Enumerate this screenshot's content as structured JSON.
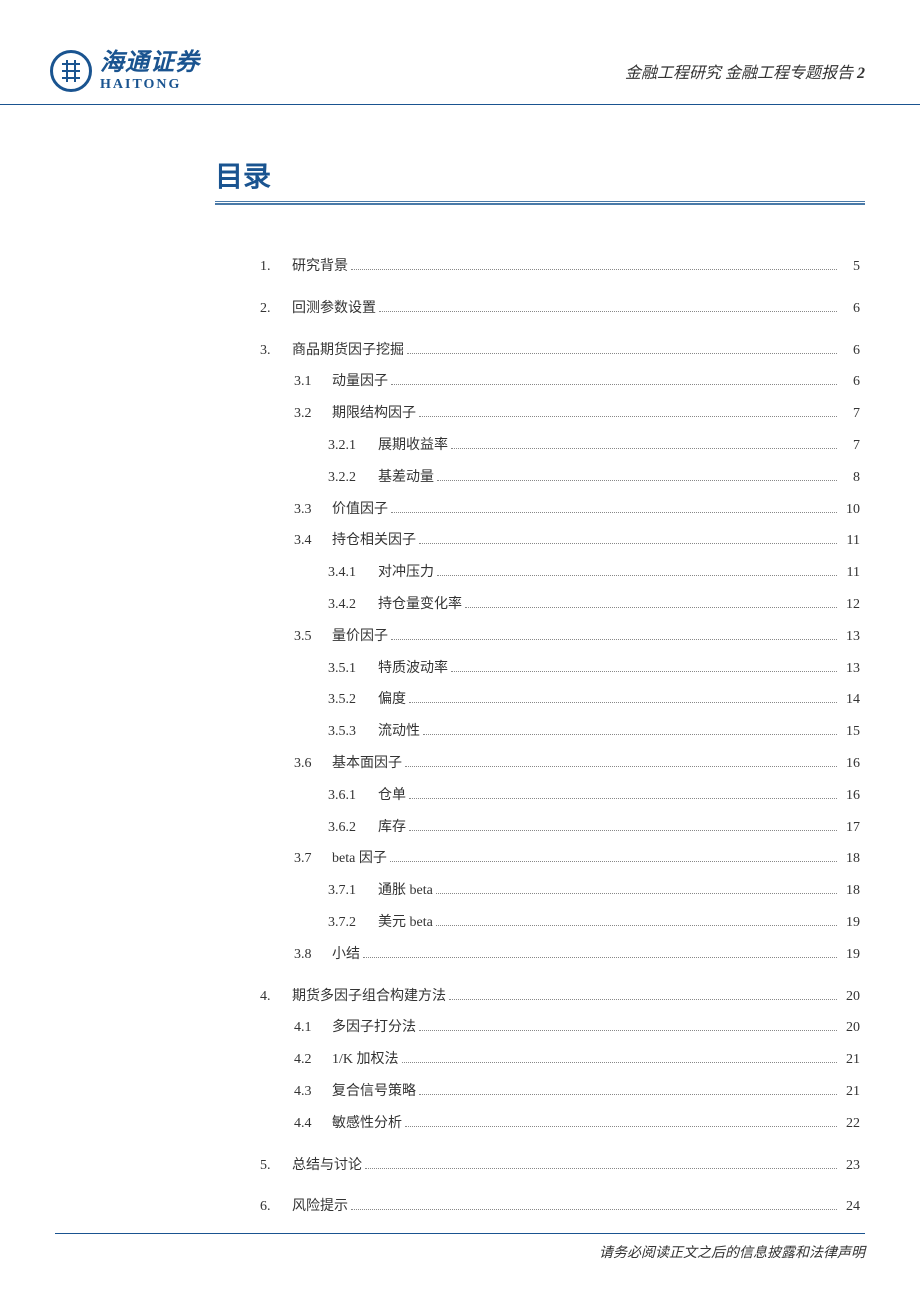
{
  "header": {
    "brand_cn": "海通证券",
    "brand_en": "HAITONG",
    "right_text_prefix": "金融工程研究 金融工程专题报告",
    "right_text_num": "2"
  },
  "title": "目录",
  "toc": [
    {
      "level": 1,
      "num": "1.",
      "label": "研究背景",
      "page": "5"
    },
    {
      "level": 1,
      "num": "2.",
      "label": "回测参数设置",
      "page": "6"
    },
    {
      "level": 1,
      "num": "3.",
      "label": "商品期货因子挖掘",
      "page": "6"
    },
    {
      "level": 2,
      "num": "3.1",
      "label": "动量因子",
      "page": "6"
    },
    {
      "level": 2,
      "num": "3.2",
      "label": "期限结构因子",
      "page": "7"
    },
    {
      "level": 3,
      "num": "3.2.1",
      "label": "展期收益率",
      "page": "7"
    },
    {
      "level": 3,
      "num": "3.2.2",
      "label": "基差动量",
      "page": "8"
    },
    {
      "level": 2,
      "num": "3.3",
      "label": "价值因子",
      "page": "10"
    },
    {
      "level": 2,
      "num": "3.4",
      "label": "持仓相关因子",
      "page": "11"
    },
    {
      "level": 3,
      "num": "3.4.1",
      "label": "对冲压力",
      "page": "11"
    },
    {
      "level": 3,
      "num": "3.4.2",
      "label": "持仓量变化率",
      "page": "12"
    },
    {
      "level": 2,
      "num": "3.5",
      "label": "量价因子",
      "page": "13"
    },
    {
      "level": 3,
      "num": "3.5.1",
      "label": "特质波动率",
      "page": "13"
    },
    {
      "level": 3,
      "num": "3.5.2",
      "label": "偏度",
      "page": "14"
    },
    {
      "level": 3,
      "num": "3.5.3",
      "label": "流动性",
      "page": "15"
    },
    {
      "level": 2,
      "num": "3.6",
      "label": "基本面因子",
      "page": "16"
    },
    {
      "level": 3,
      "num": "3.6.1",
      "label": "仓单",
      "page": "16"
    },
    {
      "level": 3,
      "num": "3.6.2",
      "label": "库存",
      "page": "17"
    },
    {
      "level": 2,
      "num": "3.7",
      "label": "beta 因子",
      "page": "18"
    },
    {
      "level": 3,
      "num": "3.7.1",
      "label": "通胀 beta",
      "page": "18"
    },
    {
      "level": 3,
      "num": "3.7.2",
      "label": "美元 beta",
      "page": "19"
    },
    {
      "level": 2,
      "num": "3.8",
      "label": "小结",
      "page": "19"
    },
    {
      "level": 1,
      "num": "4.",
      "label": "期货多因子组合构建方法",
      "page": "20"
    },
    {
      "level": 2,
      "num": "4.1",
      "label": "多因子打分法",
      "page": "20"
    },
    {
      "level": 2,
      "num": "4.2",
      "label": "1/K 加权法",
      "page": "21"
    },
    {
      "level": 2,
      "num": "4.3",
      "label": "复合信号策略",
      "page": "21"
    },
    {
      "level": 2,
      "num": "4.4",
      "label": "敏感性分析",
      "page": "22"
    },
    {
      "level": 1,
      "num": "5.",
      "label": "总结与讨论",
      "page": "23"
    },
    {
      "level": 1,
      "num": "6.",
      "label": "风险提示",
      "page": "24"
    }
  ],
  "footer": "请务必阅读正文之后的信息披露和法律声明"
}
